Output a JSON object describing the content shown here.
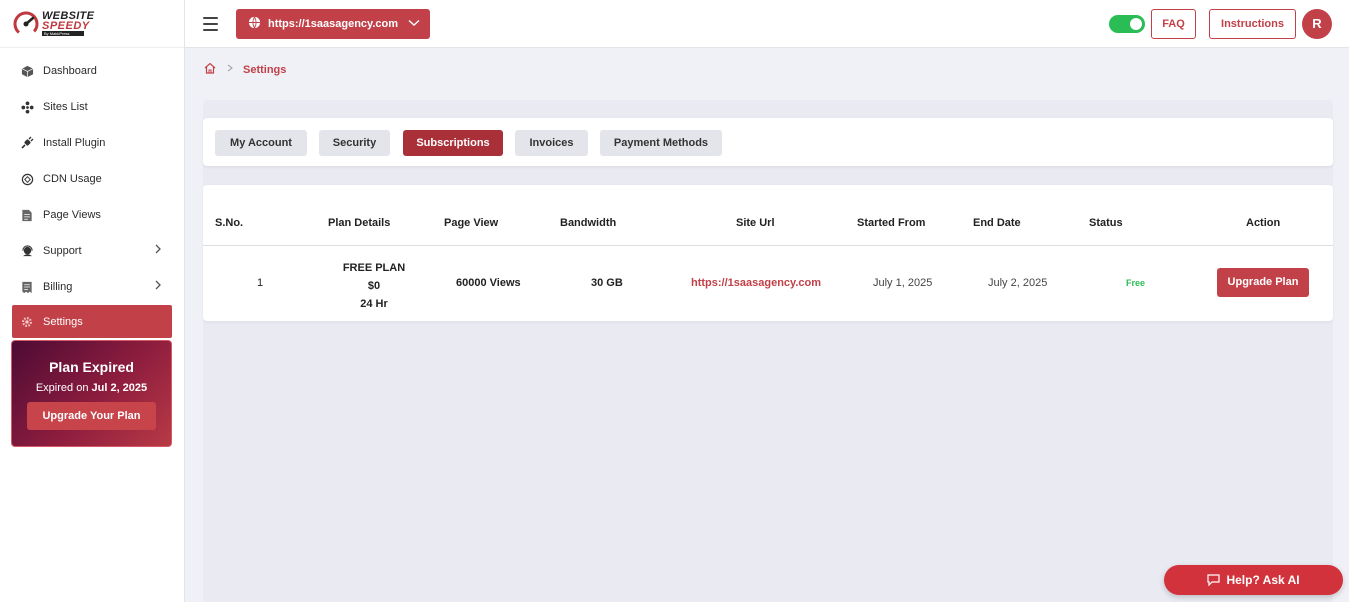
{
  "logo": {
    "line1": "WEBSITE",
    "line2": "SPEEDY",
    "line3": "By MakkPress"
  },
  "sidebar": {
    "items": [
      {
        "label": "Dashboard",
        "icon": "cube-icon"
      },
      {
        "label": "Sites List",
        "icon": "sites-icon"
      },
      {
        "label": "Install Plugin",
        "icon": "plug-icon"
      },
      {
        "label": "CDN Usage",
        "icon": "cdn-icon"
      },
      {
        "label": "Page Views",
        "icon": "document-icon"
      },
      {
        "label": "Support",
        "icon": "headset-icon"
      },
      {
        "label": "Billing",
        "icon": "billing-icon"
      },
      {
        "label": "Settings",
        "icon": "gear-icon"
      }
    ],
    "promo": {
      "title": "Plan Expired",
      "expired_prefix": "Expired on ",
      "expired_date": "Jul 2, 2025",
      "button": "Upgrade Your Plan"
    }
  },
  "topbar": {
    "site": "https://1saasagency.com",
    "faq": "FAQ",
    "instructions": "Instructions",
    "avatar": "R"
  },
  "breadcrumb": {
    "current": "Settings"
  },
  "tabs": [
    "My Account",
    "Security",
    "Subscriptions",
    "Invoices",
    "Payment Methods"
  ],
  "table": {
    "headers": [
      "S.No.",
      "Plan Details",
      "Page View",
      "Bandwidth",
      "Site Url",
      "Started From",
      "End Date",
      "Status",
      "Action"
    ],
    "row": {
      "sno": "1",
      "plan_name": "FREE PLAN",
      "plan_price": "$0",
      "plan_duration": "24 Hr",
      "page_view": "60000 Views",
      "bandwidth": "30 GB",
      "site_url": "https://1saasagency.com",
      "started": "July 1, 2025",
      "end": "July 2, 2025",
      "status": "Free",
      "action": "Upgrade Plan"
    }
  },
  "help": {
    "label": "Help? Ask AI"
  },
  "colors": {
    "accent": "#c24148",
    "success": "#2bbd55"
  }
}
